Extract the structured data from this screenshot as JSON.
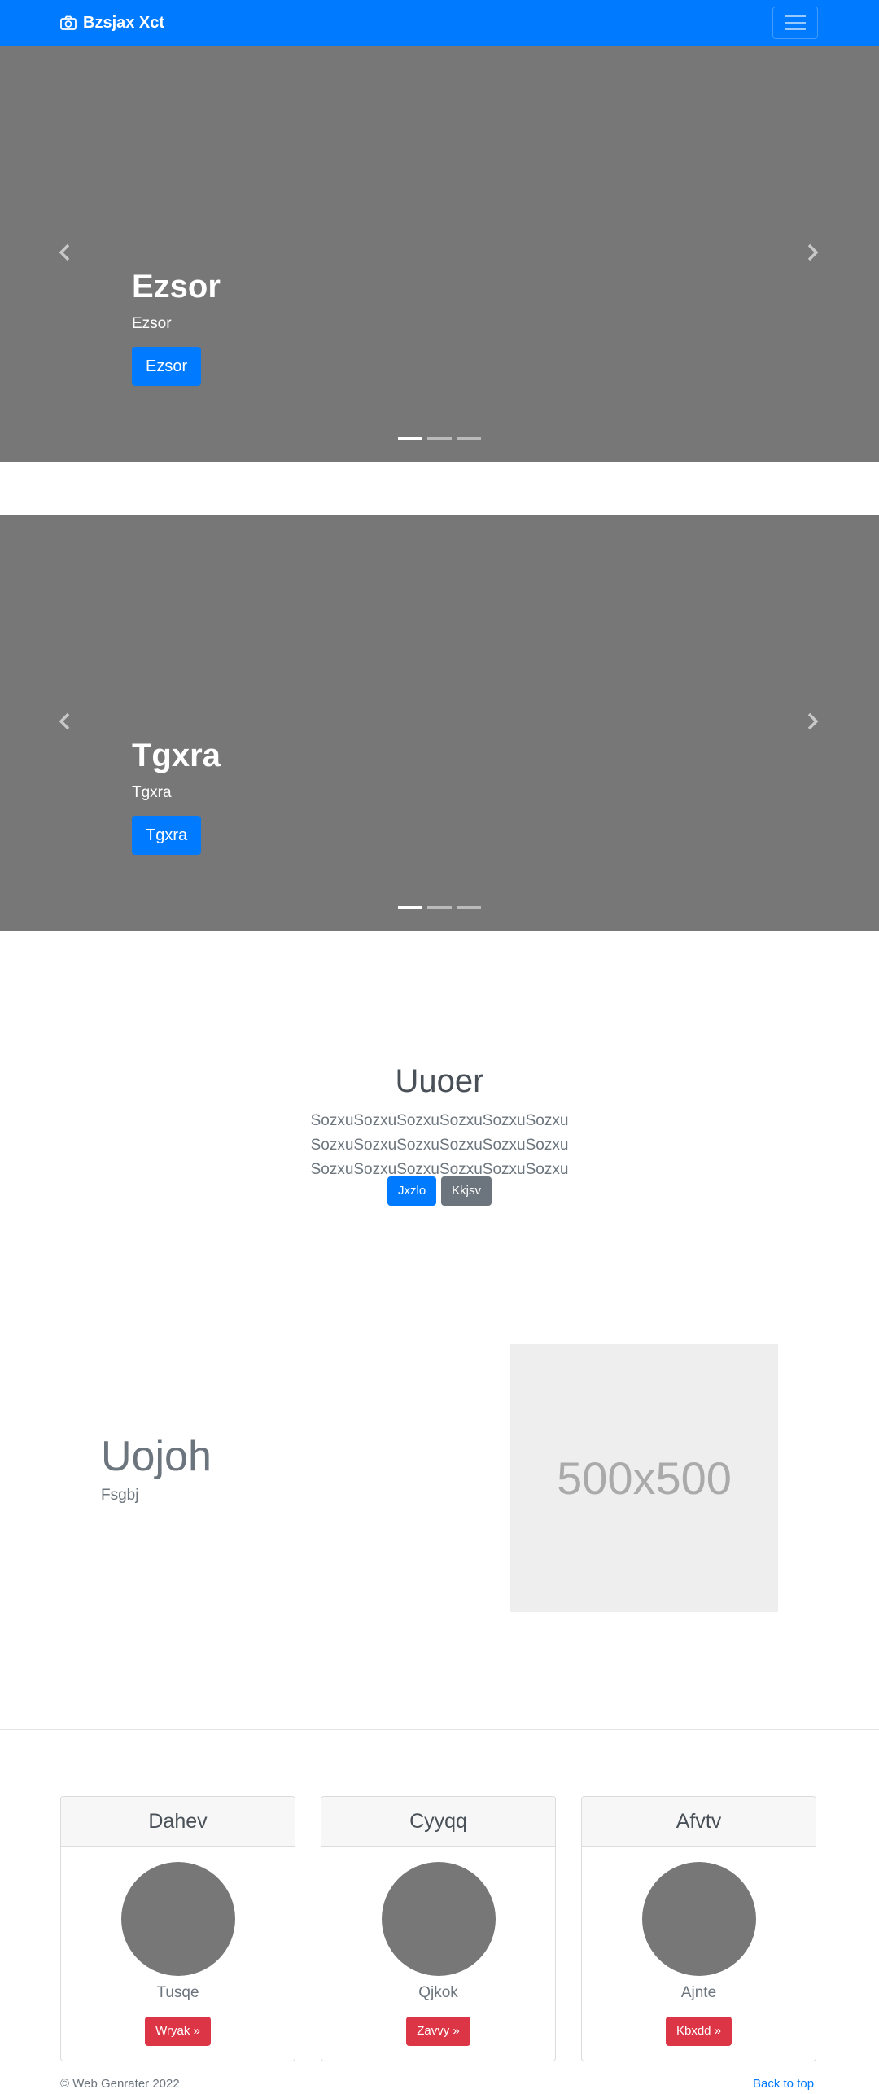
{
  "navbar": {
    "brand": "Bzsjax Xct",
    "brand_icon": "camera-icon",
    "toggler_icon": "hamburger-icon",
    "bg_color": "#007bff"
  },
  "carousels": [
    {
      "title": "Ezsor",
      "text": "Ezsor",
      "button": "Ezsor",
      "slides": 3,
      "active_slide": 1
    },
    {
      "title": "Tgxra",
      "text": "Tgxra",
      "button": "Tgxra",
      "slides": 3,
      "active_slide": 1
    }
  ],
  "jumbotron": {
    "heading": "Uuoer",
    "lead": "SozxuSozxuSozxuSozxuSozxuSozxu SozxuSozxuSozxuSozxuSozxuSozxu SozxuSozxuSozxuSozxuSozxuSozxu",
    "primary_button": "Jxzlo",
    "secondary_button": "Kkjsv"
  },
  "feature": {
    "heading": "Uojoh",
    "subtext": "Fsgbj",
    "image_label": "500x500"
  },
  "cards": [
    {
      "header": "Dahev",
      "name": "Tusqe",
      "button": "Wryak »"
    },
    {
      "header": "Cyyqq",
      "name": "Qjkok",
      "button": "Zavvy »"
    },
    {
      "header": "Afvtv",
      "name": "Ajnte",
      "button": "Kbxdd »"
    }
  ],
  "footer": {
    "copyright": "© Web Genrater 2022",
    "back_to_top": "Back to top"
  }
}
